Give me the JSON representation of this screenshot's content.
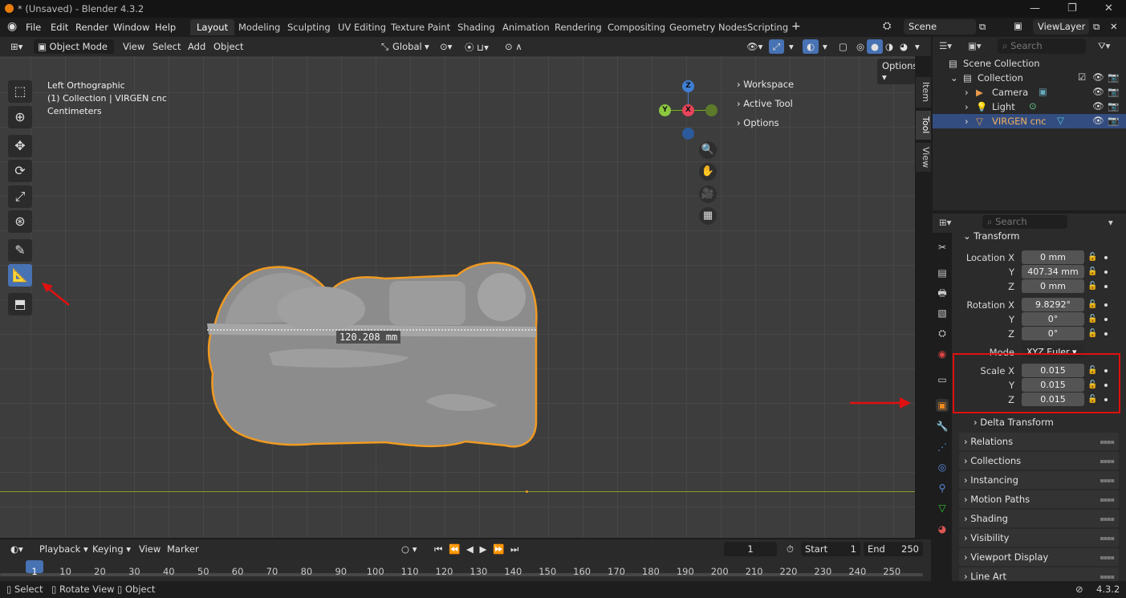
{
  "window": {
    "title": "* (Unsaved) - Blender 4.3.2"
  },
  "menus": [
    "File",
    "Edit",
    "Render",
    "Window",
    "Help"
  ],
  "workspace_tabs": [
    {
      "label": "Layout",
      "active": true
    },
    {
      "label": "Modeling"
    },
    {
      "label": "Sculpting"
    },
    {
      "label": "UV Editing"
    },
    {
      "label": "Texture Paint"
    },
    {
      "label": "Shading"
    },
    {
      "label": "Animation"
    },
    {
      "label": "Rendering"
    },
    {
      "label": "Compositing"
    },
    {
      "label": "Geometry Nodes"
    },
    {
      "label": "Scripting"
    }
  ],
  "scene": {
    "name": "Scene",
    "view_layer": "ViewLayer"
  },
  "viewport_header": {
    "mode": "Object Mode",
    "menus": [
      "View",
      "Select",
      "Add",
      "Object"
    ],
    "orientation": "Global",
    "options": "Options"
  },
  "viewport": {
    "info": [
      "Left Orthographic",
      "(1) Collection | VIRGEN cnc",
      "Centimeters"
    ],
    "measure_label": "120.208 mm",
    "gizmo": {
      "z": "Z",
      "y": "Y",
      "x": "X"
    }
  },
  "npanel": {
    "items": [
      "Workspace",
      "Active Tool",
      "Options"
    ],
    "tabs": [
      "Item",
      "Tool",
      "View"
    ]
  },
  "outliner": {
    "search_placeholder": "Search",
    "rows": [
      {
        "label": "Scene Collection"
      },
      {
        "label": "Collection"
      },
      {
        "label": "Camera"
      },
      {
        "label": "Light"
      },
      {
        "label": "VIRGEN cnc",
        "selected": true
      }
    ]
  },
  "properties": {
    "search_placeholder": "Search",
    "transform_title": "Transform",
    "location": {
      "label": "Location X",
      "x": "0 mm",
      "y": "407.34 mm",
      "z": "0 mm"
    },
    "rotation": {
      "label": "Rotation X",
      "x": "9.8292°",
      "y": "0°",
      "z": "0°"
    },
    "mode": {
      "label": "Mode",
      "value": "XYZ Euler"
    },
    "scale": {
      "label": "Scale X",
      "x": "0.015",
      "y": "0.015",
      "z": "0.015"
    },
    "axis_y": "Y",
    "axis_z": "Z",
    "panels": [
      "Delta Transform",
      "Relations",
      "Collections",
      "Instancing",
      "Motion Paths",
      "Shading",
      "Visibility",
      "Viewport Display",
      "Line Art"
    ]
  },
  "timeline": {
    "menus": [
      "Playback",
      "Keying",
      "View",
      "Marker"
    ],
    "current_frame": "1",
    "start_label": "Start",
    "start": "1",
    "end_label": "End",
    "end": "250",
    "frames": [
      "1",
      "10",
      "20",
      "30",
      "40",
      "50",
      "60",
      "70",
      "80",
      "90",
      "100",
      "110",
      "120",
      "130",
      "140",
      "150",
      "160",
      "170",
      "180",
      "190",
      "200",
      "210",
      "220",
      "230",
      "240",
      "250"
    ]
  },
  "statusbar": {
    "items": [
      "Select",
      "Rotate View",
      "Object"
    ],
    "version": "4.3.2"
  },
  "colors": {
    "accent": "#4772b3",
    "selection_outline": "#f09a22",
    "annotation_red": "#e01010"
  }
}
